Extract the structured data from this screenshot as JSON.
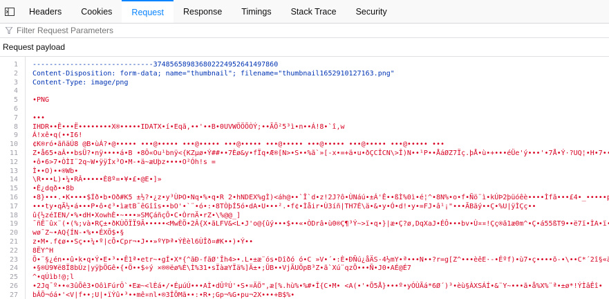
{
  "tabs": [
    {
      "label": "Headers",
      "active": false
    },
    {
      "label": "Cookies",
      "active": false
    },
    {
      "label": "Request",
      "active": true
    },
    {
      "label": "Response",
      "active": false
    },
    {
      "label": "Timings",
      "active": false
    },
    {
      "label": "Stack Trace",
      "active": false
    },
    {
      "label": "Security",
      "active": false
    }
  ],
  "filter": {
    "placeholder": "Filter Request Parameters"
  },
  "section_title": "Request payload",
  "lines": [
    {
      "n": "1",
      "text": "-----------------------------374856589836802224952641497860",
      "kind": "text"
    },
    {
      "n": "2",
      "text": "Content-Disposition: form-data; name=\"thumbnail\"; filename=\"thumbnail1652910127163.png\"",
      "kind": "text"
    },
    {
      "n": "3",
      "text": "Content-Type: image/png",
      "kind": "text"
    },
    {
      "n": "4",
      "text": "",
      "kind": "text"
    },
    {
      "n": "5",
      "text": "•PNG",
      "kind": "bin"
    },
    {
      "n": "6",
      "text": "",
      "kind": "bin"
    },
    {
      "n": "7",
      "text": "•••",
      "kind": "bin"
    },
    {
      "n": "8",
      "text": "IHDR••Ê•••Ë••••••••X®•••••IDATX•í•Eqã,••'••B•0UVWÖÖÕÒÝ;••ÃÕ²5³ì•n••Á!8•`î,w",
      "kind": "bin"
    },
    {
      "n": "9",
      "text": "Á!xê•q(••I6!",
      "kind": "bin"
    },
    {
      "n": "10",
      "text": "¢K®ró•ãñäÚ8 @B•ùÁ?•@••••• •••@••••• •••@••••• •••@••••• •••@••••• •••@••••• •••@••••• •••@••••• •••",
      "kind": "bin"
    },
    {
      "n": "11",
      "text": "Z•å65•aÂ••bsÜ?•nÿ••••á•B •8Ô«Ou¹bnÿ<{KZµø•Ý##••7Èø&y•fÏq•Æ®[N>•S••%ã`»[-x•=+ä•u•ðÇCÎCN\\>Î)N••¹P••ÅáØZ7Ïç.þÅ•ù•+•••éÜe'ý•••'•7Å•Ý·?UQ¦•H•7•••",
      "kind": "bin"
    },
    {
      "n": "12",
      "text": "•ô•6>7•ÒÌI¨2q~W•ÿÿÍx³O•M-•ä~æUþz••••O²Óh!s =",
      "kind": "bin"
    },
    {
      "n": "13",
      "text": "Ì••O)••®Wb•",
      "kind": "bin"
    },
    {
      "n": "14",
      "text": "\\R•••L)•¼•RÂ•••••È8º=•¥•£•@E•]»",
      "kind": "bin"
    },
    {
      "n": "15",
      "text": "•È¿dqð••8b",
      "kind": "bin"
    },
    {
      "n": "16",
      "text": "•8}•••.•K••••$Íð•b•Oð#K5 ±½?•¿z•y³ÙÞO•Nq•%•q•R 2•hNDEX%gÌ)<áh@••`Î`d•z!2J?ô•ÙNáú•±Á'Ê••ßÌ%0ì•é¦^•8N%•o•f•Ñö¨ì•kÚÞ2þüóêè••••Ìfã•••£4•_•••••p•=•",
      "kind": "bin"
    },
    {
      "n": "17",
      "text": "•••ty•qÃ½•á•••P•ô•¢³•ìætB¯êGîîs••bO'•`¨•ó•:•8TÒþÍ5ó•dA•U•••².•f¢•Ìåir•Ù3íñ|TH7É\\ä•&•y•Ó•d!•y•=FJ•â¹¡\"•••ÃBãý••Ç•%U|ÿÌÇç••",
      "kind": "bin"
    },
    {
      "n": "18",
      "text": "û{½zéIEN/•%•dH•XowhÈ•~•••»SMÇáñçÔ•C•ÒrnÄ•rZ•\\%@@_]",
      "kind": "bin"
    },
    {
      "n": "19",
      "text": "¯ñÊ¨ûx¨(•(%;và•RÇ±•ðKÙÖÏÏ9Ã•••••<MwÈÖ•2Â{X•ãLFV&<L•J'o@{ûý•••$••«•ÒDrâ•ù0®Ç¶³Ý~>ï•q•}|æ•Ç?ø,DqXaJ•ÉÔ•••bv•Ù¤¤!Çç®ã1æ0m^•Ç•á55ßT9••ë7ï•ÌA•ï•½>2•",
      "kind": "bin"
    },
    {
      "n": "20",
      "text": "wø¯Z~•AQ{ÍN-•%••ÉXÕ$•§",
      "kind": "bin"
    },
    {
      "n": "21",
      "text": "z•M•.f¢ø••Sç••¼•º|cÕ•Cpr¬•J••»ºYÞª•ÝÈèl6ÙÎð¤#K••)•Ý••",
      "kind": "bin"
    },
    {
      "n": "22",
      "text": "8ËY^H",
      "kind": "bin"
    },
    {
      "n": "23",
      "text": "Õ•¨§¿én••û•k•q•Ý•E•³••Ê1ª•etr~•gÍ•X*{^ãÐ-fãØ'Îh4>•.L•±æ¨ós•Dîðó ó•C »V•´•:È•ÐÑú¿åÄS-4½mY•ª•••N••?r=g[Z^•••èêE·-•Éºf)•ù7•ç••••õ-•\\••C*´2î§«ä•",
      "kind": "bin"
    },
    {
      "n": "24",
      "text": "•§®Ù9¥ë8Ï8bÚz|yÿþÖGê•{•Ö••$÷ý ×®®ëø%È\\Ì%31•sÏàæYÏä%]Ä±•;ÜB••VjÃUÖpB³Z•ã`Xú¨qzÕ•••Ñ•J0•AÉ@É7",
      "kind": "bin"
    },
    {
      "n": "25",
      "text": "^•qÚìb!@;l",
      "kind": "bin"
    },
    {
      "n": "26",
      "text": "•2Jq¯º••«3ûÕê3•OôìFúrÔ`•Eæ~<lÈá•/•ÉµúÚ•••AÌ•dÛºÚ'•S•¤ÄÖ\",æ[%.hù%•%#•Î{C•M• <A(•'•Õ5Å}•••º•yÓÙÃá*6Ø´)³•èù§ÀXSÁÍ•&¨Y~•••ã•å%X%¨ª•±ø*!ÝÌâÊî•",
      "kind": "bin"
    },
    {
      "n": "27",
      "text": "bÂÕ¬óá•'<V|f••;U|•ïÝû•³••mê¤nl•®3ÎÕMã••:•R•;Gp¬%G•pu¬2X•••+B$%•",
      "kind": "bin"
    }
  ]
}
